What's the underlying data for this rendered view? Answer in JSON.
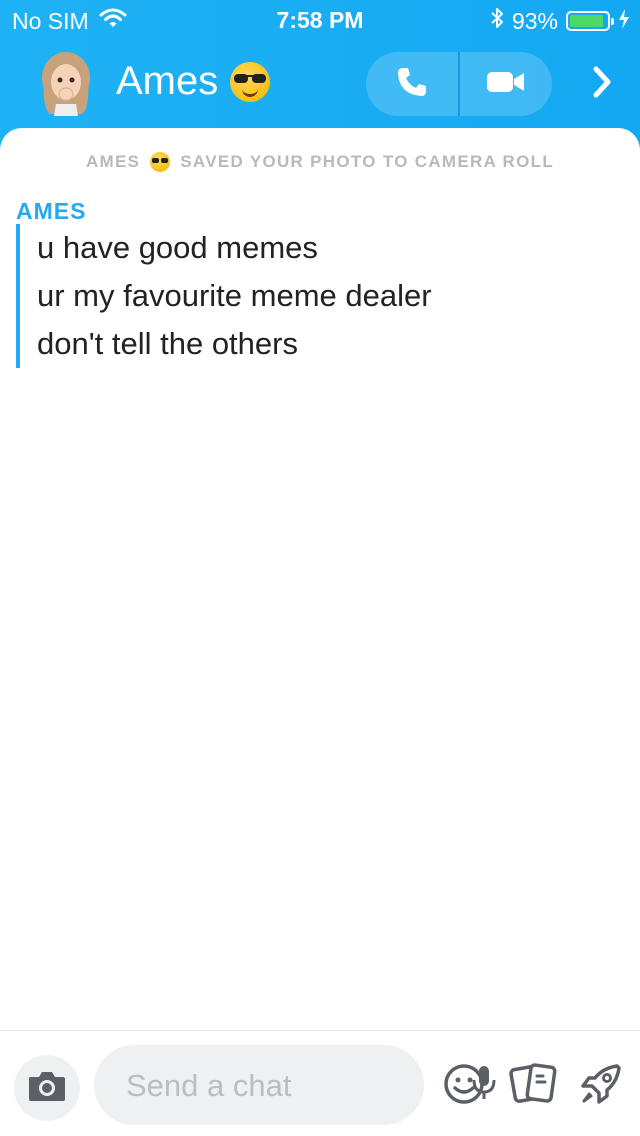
{
  "status_bar": {
    "carrier": "No SIM",
    "time": "7:58 PM",
    "battery_percent": "93%",
    "battery_level": 0.93,
    "icons": [
      "wifi-icon",
      "bluetooth-icon",
      "battery-icon",
      "charging-bolt-icon"
    ]
  },
  "header": {
    "contact_name": "Ames",
    "name_emoji": "smiling-face-with-sunglasses",
    "buttons": [
      "phone-icon",
      "video-camera-icon",
      "chevron-right-icon"
    ]
  },
  "chat": {
    "system_notice": {
      "name": "AMES",
      "text": "SAVED YOUR PHOTO TO CAMERA ROLL"
    },
    "sender": "AMES",
    "messages": [
      "u have good memes",
      "ur my favourite meme dealer",
      "don't tell the others"
    ]
  },
  "composer": {
    "placeholder": "Send a chat",
    "value": "",
    "icons": [
      "camera-icon",
      "microphone-icon",
      "smiley-icon",
      "stickers-icon",
      "rocket-icon"
    ]
  },
  "colors": {
    "accent": "#27a9ef",
    "header_bg": "#1aaef4",
    "battery": "#4cd964"
  }
}
